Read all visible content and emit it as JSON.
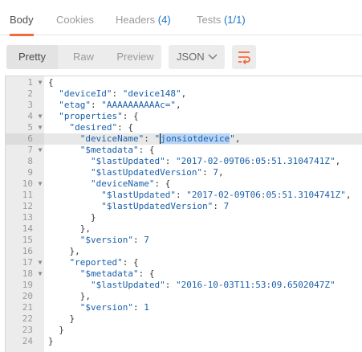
{
  "tabs": {
    "body": "Body",
    "cookies": "Cookies",
    "headers": "Headers",
    "headers_count": "(4)",
    "tests": "Tests",
    "tests_count": "(1/1)"
  },
  "toolbar": {
    "pretty": "Pretty",
    "raw": "Raw",
    "preview": "Preview",
    "format": "JSON",
    "chevron_icon": "chevron-down-icon",
    "wrap_icon": "wrap-lines-icon",
    "accent": "#f26b3a"
  },
  "editor": {
    "active_line": 6,
    "selected_text": "jonsiotdevice",
    "lines": [
      {
        "num": "1",
        "fold": "▼",
        "code": "{"
      },
      {
        "num": "2",
        "fold": "",
        "code": "  \"deviceId\": \"device148\","
      },
      {
        "num": "3",
        "fold": "",
        "code": "  \"etag\": \"AAAAAAAAAAc=\","
      },
      {
        "num": "4",
        "fold": "▼",
        "code": "  \"properties\": {"
      },
      {
        "num": "5",
        "fold": "▼",
        "code": "    \"desired\": {"
      },
      {
        "num": "6",
        "fold": "",
        "code": "      \"deviceName\": \"jonsiotdevice\","
      },
      {
        "num": "7",
        "fold": "▼",
        "code": "      \"$metadata\": {"
      },
      {
        "num": "8",
        "fold": "",
        "code": "        \"$lastUpdated\": \"2017-02-09T06:05:51.3104741Z\","
      },
      {
        "num": "9",
        "fold": "",
        "code": "        \"$lastUpdatedVersion\": 7,"
      },
      {
        "num": "10",
        "fold": "▼",
        "code": "        \"deviceName\": {"
      },
      {
        "num": "11",
        "fold": "",
        "code": "          \"$lastUpdated\": \"2017-02-09T06:05:51.3104741Z\","
      },
      {
        "num": "12",
        "fold": "",
        "code": "          \"$lastUpdatedVersion\": 7"
      },
      {
        "num": "13",
        "fold": "",
        "code": "        }"
      },
      {
        "num": "14",
        "fold": "",
        "code": "      },"
      },
      {
        "num": "15",
        "fold": "",
        "code": "      \"$version\": 7"
      },
      {
        "num": "16",
        "fold": "",
        "code": "    },"
      },
      {
        "num": "17",
        "fold": "▼",
        "code": "    \"reported\": {"
      },
      {
        "num": "18",
        "fold": "▼",
        "code": "      \"$metadata\": {"
      },
      {
        "num": "19",
        "fold": "",
        "code": "        \"$lastUpdated\": \"2016-10-03T11:53:09.6502047Z\""
      },
      {
        "num": "20",
        "fold": "",
        "code": "      },"
      },
      {
        "num": "21",
        "fold": "",
        "code": "      \"$version\": 1"
      },
      {
        "num": "22",
        "fold": "",
        "code": "    }"
      },
      {
        "num": "23",
        "fold": "",
        "code": "  }"
      },
      {
        "num": "24",
        "fold": "",
        "code": "}"
      }
    ]
  }
}
